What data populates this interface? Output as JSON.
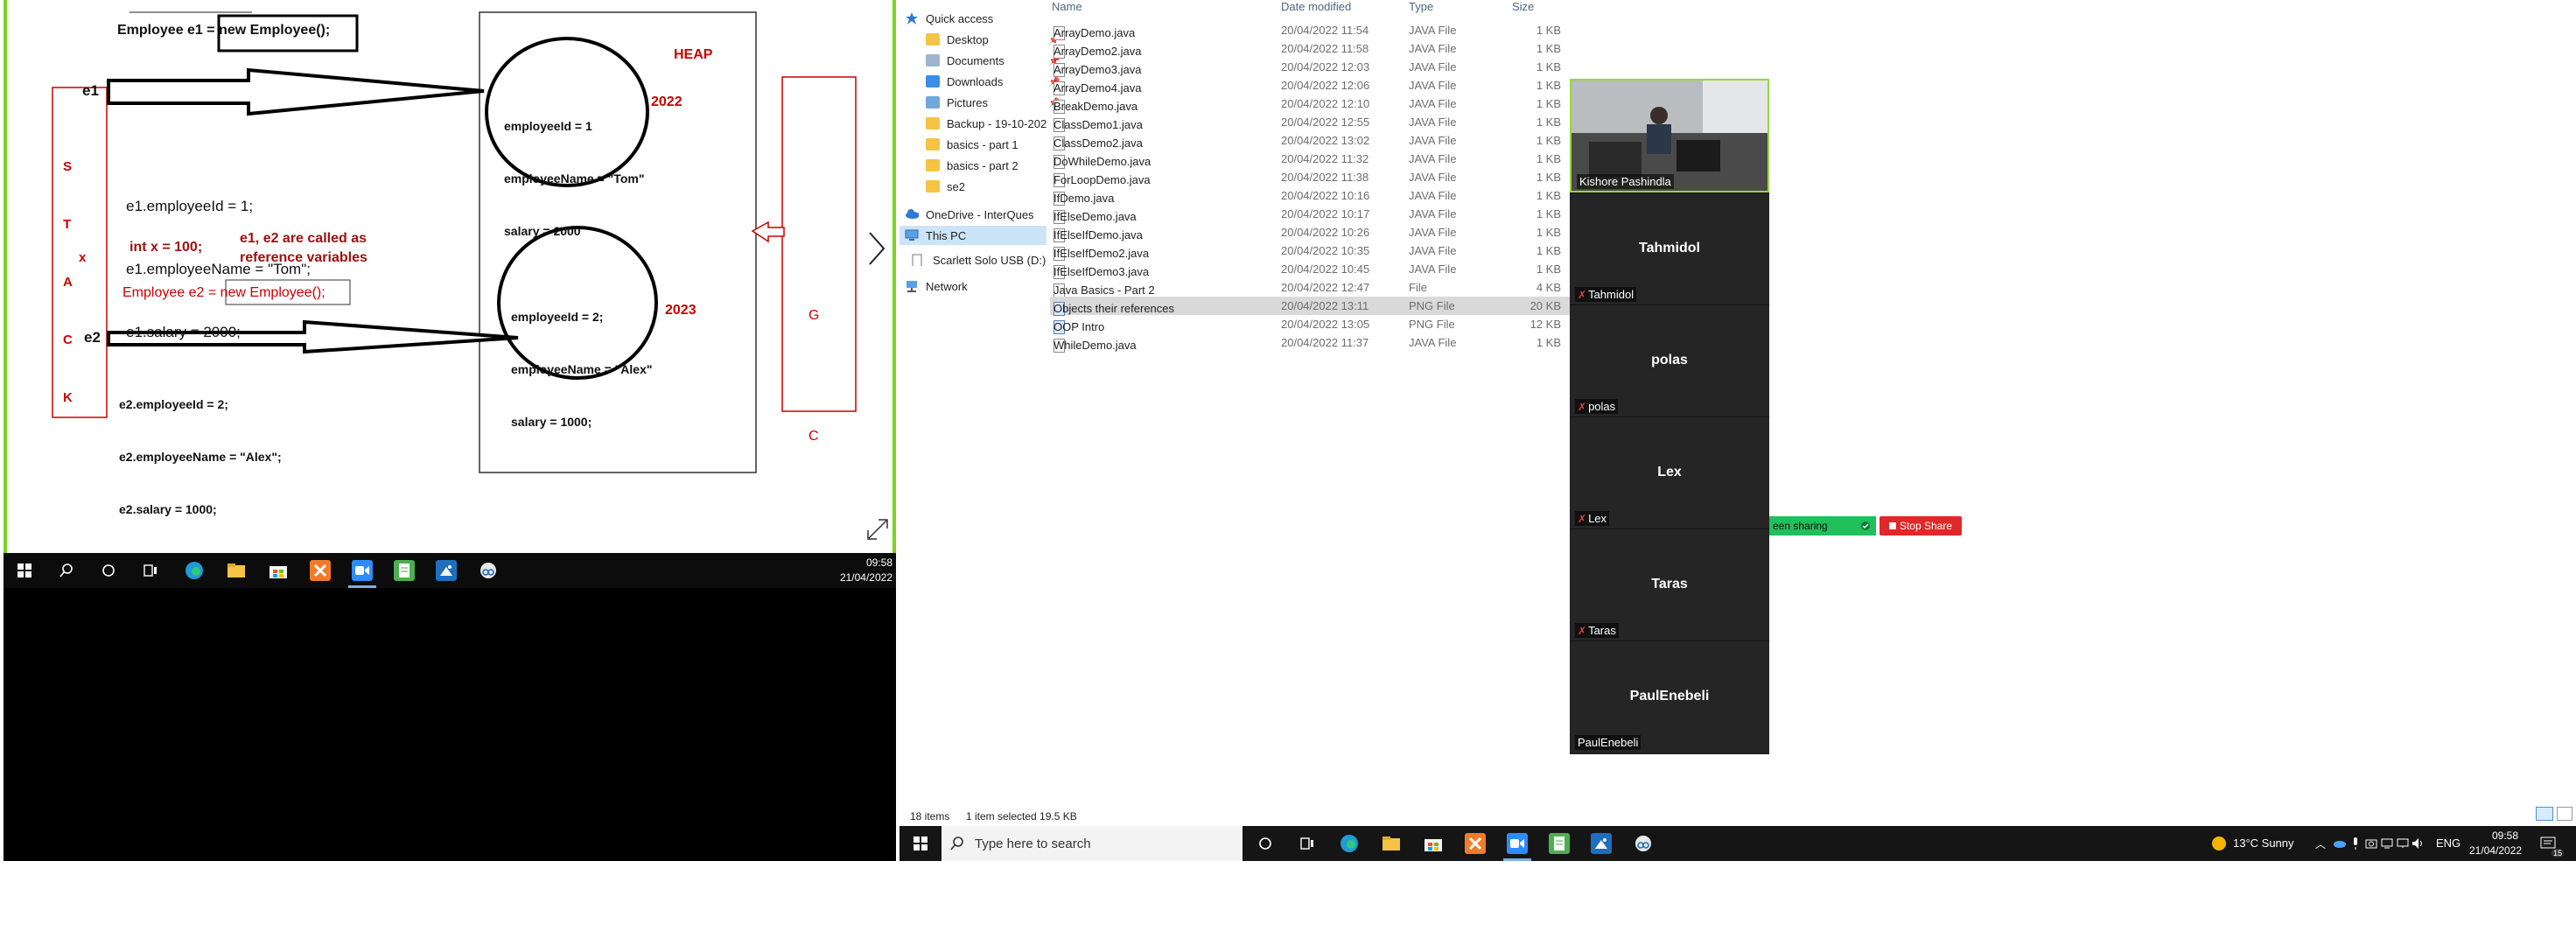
{
  "whiteboard": {
    "line1": "Employee e1 = new Employee();",
    "e1_label": "e1",
    "stack_letters": [
      "S",
      "T",
      "A",
      "C",
      "K"
    ],
    "stack_x": "x",
    "code_e1": [
      "e1.employeeId = 1;",
      "e1.employeeName = \"Tom\";",
      "e1.salary = 2000;"
    ],
    "int_x": "int x = 100;",
    "ref_note": "e1, e2 are called as\nreference variables",
    "line_e2": "Employee e2 = new Employee();",
    "e2_label": "e2",
    "code_e2": [
      "e2.employeeId = 2;",
      "e2.employeeName = \"Alex\";",
      "e2.salary = 1000;"
    ],
    "heap": "HEAP",
    "obj1": [
      "employeeId = 1",
      "employeeName = \"Tom\"",
      "salary = 2000"
    ],
    "year1": "2022",
    "obj2": [
      "employeeId = 2;",
      "employeeName = \"Alex\"",
      "salary = 1000;"
    ],
    "year2": "2023",
    "gc": [
      "G",
      "C"
    ]
  },
  "left_taskbar": {
    "time": "09:58",
    "date": "21/04/2022"
  },
  "explorer": {
    "nav": {
      "quick_access": "Quick access",
      "items": [
        "Desktop",
        "Documents",
        "Downloads",
        "Pictures",
        "Backup - 19-10-202",
        "basics - part 1",
        "basics - part 2",
        "se2"
      ],
      "onedrive": "OneDrive - InterQues",
      "this_pc": "This PC",
      "usb": "Scarlett Solo USB (D:)",
      "network": "Network"
    },
    "columns": [
      "Name",
      "Date modified",
      "Type",
      "Size"
    ],
    "files": [
      {
        "name": "ArrayDemo.java",
        "date": "20/04/2022 11:54",
        "type": "JAVA File",
        "size": "1 KB"
      },
      {
        "name": "ArrayDemo2.java",
        "date": "20/04/2022 11:58",
        "type": "JAVA File",
        "size": "1 KB"
      },
      {
        "name": "ArrayDemo3.java",
        "date": "20/04/2022 12:03",
        "type": "JAVA File",
        "size": "1 KB"
      },
      {
        "name": "ArrayDemo4.java",
        "date": "20/04/2022 12:06",
        "type": "JAVA File",
        "size": "1 KB"
      },
      {
        "name": "BreakDemo.java",
        "date": "20/04/2022 12:10",
        "type": "JAVA File",
        "size": "1 KB"
      },
      {
        "name": "ClassDemo1.java",
        "date": "20/04/2022 12:55",
        "type": "JAVA File",
        "size": "1 KB"
      },
      {
        "name": "ClassDemo2.java",
        "date": "20/04/2022 13:02",
        "type": "JAVA File",
        "size": "1 KB"
      },
      {
        "name": "DoWhileDemo.java",
        "date": "20/04/2022 11:32",
        "type": "JAVA File",
        "size": "1 KB"
      },
      {
        "name": "ForLoopDemo.java",
        "date": "20/04/2022 11:38",
        "type": "JAVA File",
        "size": "1 KB"
      },
      {
        "name": "IfDemo.java",
        "date": "20/04/2022 10:16",
        "type": "JAVA File",
        "size": "1 KB"
      },
      {
        "name": "IfElseDemo.java",
        "date": "20/04/2022 10:17",
        "type": "JAVA File",
        "size": "1 KB"
      },
      {
        "name": "IfElseIfDemo.java",
        "date": "20/04/2022 10:26",
        "type": "JAVA File",
        "size": "1 KB"
      },
      {
        "name": "IfElseIfDemo2.java",
        "date": "20/04/2022 10:35",
        "type": "JAVA File",
        "size": "1 KB"
      },
      {
        "name": "IfElseIfDemo3.java",
        "date": "20/04/2022 10:45",
        "type": "JAVA File",
        "size": "1 KB"
      },
      {
        "name": "Java Basics - Part 2",
        "date": "20/04/2022 12:47",
        "type": "File",
        "size": "4 KB"
      },
      {
        "name": "Objects their references",
        "date": "20/04/2022 13:11",
        "type": "PNG File",
        "size": "20 KB"
      },
      {
        "name": "OOP Intro",
        "date": "20/04/2022 13:05",
        "type": "PNG File",
        "size": "12 KB"
      },
      {
        "name": "WhileDemo.java",
        "date": "20/04/2022 11:37",
        "type": "JAVA File",
        "size": "1 KB"
      }
    ],
    "status_items": "18 items",
    "status_selected": "1 item selected  19.5 KB"
  },
  "gallery": {
    "video_name": "Kishore Pashindla",
    "participants": [
      {
        "name": "Tahmidol",
        "label": "Tahmidol"
      },
      {
        "name": "polas",
        "label": "polas"
      },
      {
        "name": "Lex",
        "label": "Lex"
      },
      {
        "name": "Taras",
        "label": "Taras"
      },
      {
        "name": "PaulEnebeli",
        "label": "PaulEnebeli"
      }
    ],
    "sharing_text": "een sharing",
    "stop_share": "Stop Share"
  },
  "taskbar": {
    "search_placeholder": "Type here to search",
    "weather": "13°C  Sunny",
    "language": "ENG",
    "time": "09:58",
    "date": "21/04/2022",
    "notifications": "15"
  },
  "colors": {
    "share_border": "#7ed321",
    "drawing_red": "#cc0000",
    "stop_share": "#e02828",
    "sharing_green": "#20c05c"
  }
}
